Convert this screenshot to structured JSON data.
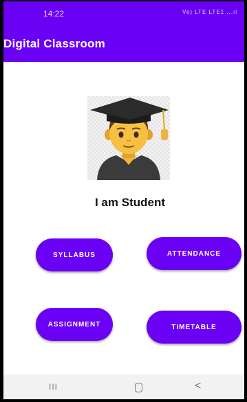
{
  "status_bar": {
    "time": "14:22",
    "indicators": "Vo) LTE LTE1 ...ıl"
  },
  "app_bar": {
    "title": "Digital Classroom"
  },
  "main": {
    "avatar_icon": "student-graduate-icon",
    "heading": "I am Student",
    "buttons": {
      "syllabus": "SYLLABUS",
      "attendance": "ATTENDANCE",
      "assignment": "ASSIGNMENT",
      "timetable": "TIMETABLE"
    }
  },
  "nav_bar": {
    "recent": "III",
    "back": "<"
  },
  "colors": {
    "primary": "#6a00f4",
    "button_text": "#ffffff",
    "heading": "#111111"
  }
}
